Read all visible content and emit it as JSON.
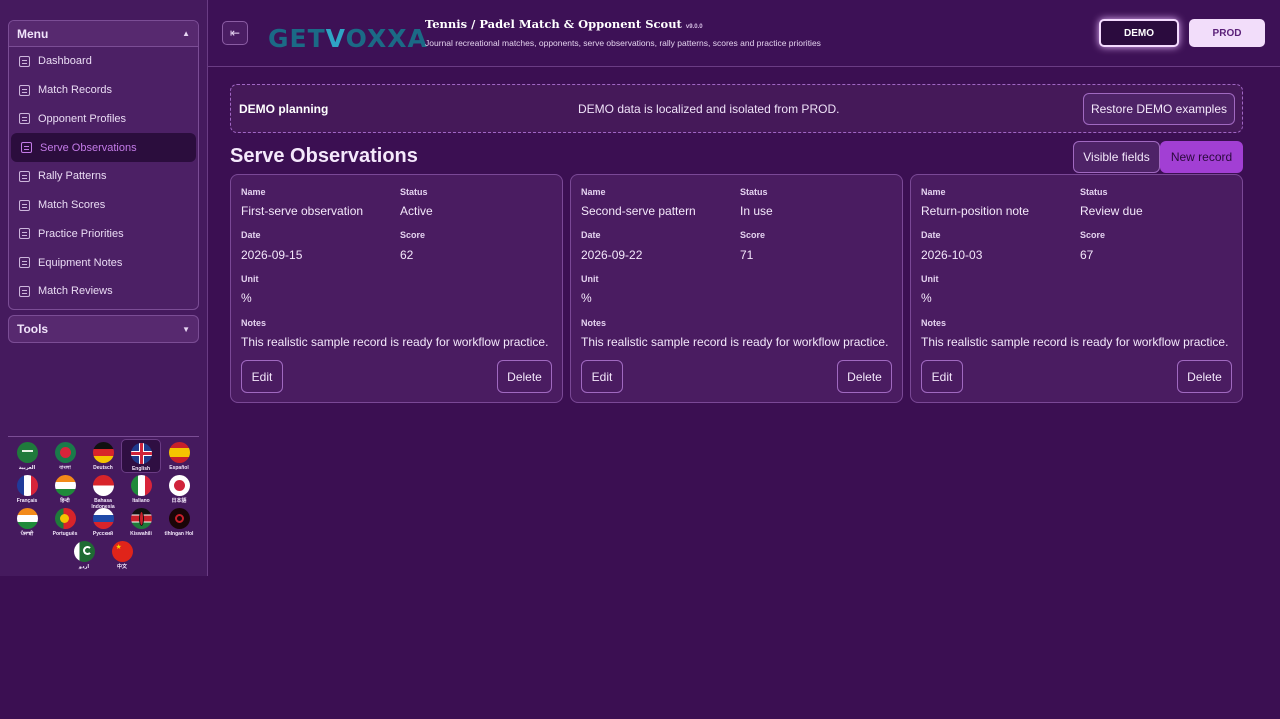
{
  "sidebar": {
    "menu_label": "Menu",
    "tools_label": "Tools",
    "items": [
      {
        "label": "Dashboard",
        "active": false
      },
      {
        "label": "Match Records",
        "active": false
      },
      {
        "label": "Opponent Profiles",
        "active": false
      },
      {
        "label": "Serve Observations",
        "active": true
      },
      {
        "label": "Rally Patterns",
        "active": false
      },
      {
        "label": "Match Scores",
        "active": false
      },
      {
        "label": "Practice Priorities",
        "active": false
      },
      {
        "label": "Equipment Notes",
        "active": false
      },
      {
        "label": "Match Reviews",
        "active": false
      }
    ],
    "languages": [
      {
        "name": "العربية",
        "icon": "saudi-flag-icon"
      },
      {
        "name": "বাংলা",
        "icon": "bangladesh-flag-icon"
      },
      {
        "name": "Deutsch",
        "icon": "germany-flag-icon"
      },
      {
        "name": "English",
        "icon": "uk-flag-icon",
        "selected": true
      },
      {
        "name": "Español",
        "icon": "spain-flag-icon"
      },
      {
        "name": "Français",
        "icon": "france-flag-icon"
      },
      {
        "name": "हिन्दी",
        "icon": "india-flag-icon"
      },
      {
        "name": "Bahasa Indonesia",
        "icon": "indonesia-flag-icon"
      },
      {
        "name": "Italiano",
        "icon": "italy-flag-icon"
      },
      {
        "name": "日本語",
        "icon": "japan-flag-icon"
      },
      {
        "name": "ਪੰਜਾਬੀ",
        "icon": "india-flag-icon"
      },
      {
        "name": "Português",
        "icon": "portugal-flag-icon"
      },
      {
        "name": "Русский",
        "icon": "russia-flag-icon"
      },
      {
        "name": "Kiswahili",
        "icon": "kenya-flag-icon"
      },
      {
        "name": "tlhIngan Hol",
        "icon": "klingon-flag-icon"
      },
      {
        "name": "اردو",
        "icon": "pakistan-flag-icon"
      },
      {
        "name": "中文",
        "icon": "china-flag-icon"
      }
    ]
  },
  "header": {
    "logo_prefix": "GET",
    "logo_suffix": "OXXA",
    "logo_v": "V",
    "title": "Tennis / Padel Match & Opponent Scout",
    "version": "v9.0.0",
    "subtitle": "Journal recreational matches, opponents, serve observations, rally patterns, scores and practice priorities",
    "demo_label": "DEMO",
    "prod_label": "PROD"
  },
  "banner": {
    "title": "DEMO planning",
    "message": "DEMO data is localized and isolated from PROD.",
    "restore_label": "Restore DEMO examples"
  },
  "section": {
    "title": "Serve Observations",
    "visible_fields_label": "Visible fields",
    "new_record_label": "New record"
  },
  "field_labels": {
    "name": "Name",
    "status": "Status",
    "date": "Date",
    "score": "Score",
    "unit": "Unit",
    "notes": "Notes",
    "edit": "Edit",
    "delete": "Delete"
  },
  "records": [
    {
      "name": "First-serve observation",
      "status": "Active",
      "date": "2026-09-15",
      "score": "62",
      "unit": "%",
      "notes": "This realistic sample record is ready for workflow practice."
    },
    {
      "name": "Second-serve pattern",
      "status": "In use",
      "date": "2026-09-22",
      "score": "71",
      "unit": "%",
      "notes": "This realistic sample record is ready for workflow practice."
    },
    {
      "name": "Return-position note",
      "status": "Review due",
      "date": "2026-10-03",
      "score": "67",
      "unit": "%",
      "notes": "This realistic sample record is ready for workflow practice."
    }
  ],
  "colors": {
    "background": "#3b0f52",
    "accent": "#a23fd4",
    "active_item": "#c47be8"
  }
}
